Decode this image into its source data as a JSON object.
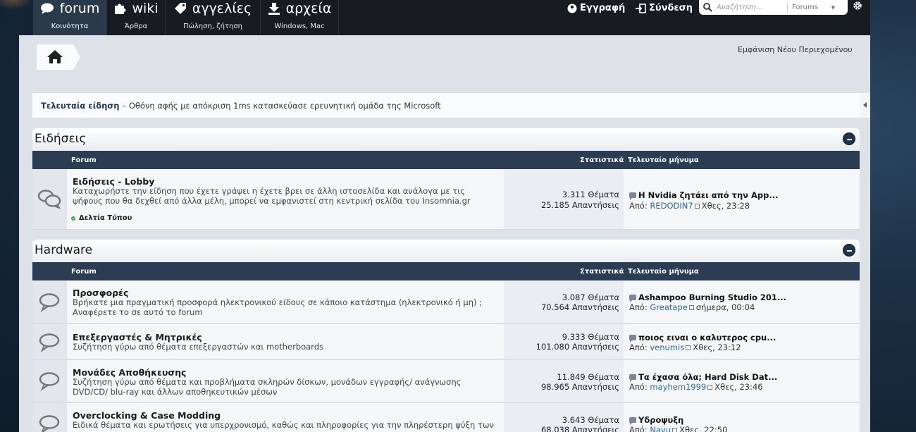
{
  "nav": {
    "tabs": [
      {
        "label": "forum",
        "sub": "Κοινότητα"
      },
      {
        "label": "wiki",
        "sub": "Άρθρα"
      },
      {
        "label": "αγγελίες",
        "sub": "Πώληση, ζήτηση"
      },
      {
        "label": "αρχεία",
        "sub": "Windows, Mac"
      }
    ],
    "register": "Εγγραφή",
    "login": "Σύνδεση",
    "search_placeholder": "Αναζήτηση...",
    "search_scope": "Forums"
  },
  "whats_new": "Εμφάνιση Νέου Περιεχομένου",
  "news": {
    "label": "Τελευταία είδηση",
    "text": "– Οθόνη αφής με απόκριση 1ms κατασκεύασε ερευνητική ομάδα της Microsoft"
  },
  "columns": {
    "forum": "Forum",
    "stats": "Στατιστικά",
    "last": "Τελευταίο μήνυμα"
  },
  "sections": [
    {
      "title": "Ειδήσεις",
      "forums": [
        {
          "title": "Ειδήσεις - Lobby",
          "desc": "Καταχωρήστε την είδηση που έχετε γράψει η έχετε βρει σε άλλη ιστοσελίδα και ανάλογα με τις ψήφους που θα δεχθεί από άλλα μέλη, μπορεί να εμφανιστεί στη κεντρική σελίδα του Insomnia.gr",
          "subforum": "Δελτία Τύπου",
          "threads": "3.311 Θέματα",
          "posts": "25.185 Απαντήσεις",
          "last_title": "Η Nvidia ζητάει από την App...",
          "by": "Από:",
          "user": "REDODIN7",
          "time": "Χθες, 23:28"
        }
      ]
    },
    {
      "title": "Hardware",
      "forums": [
        {
          "title": "Προσφορές",
          "desc": "Βρήκατε μια πραγματική προσφορά ηλεκτρονικού είδους σε κάποιο κατάστημα (ηλεκτρονικό ή μη) ; Αναφέρετε το σε αυτό το forum",
          "threads": "3.087 Θέματα",
          "posts": "70.564 Απαντήσεις",
          "last_title": "Ashampoo Burning Studio 201...",
          "by": "Από:",
          "user": "Greatape",
          "time": "σήμερα, 00:04"
        },
        {
          "title": "Επεξεργαστές & Μητρικές",
          "desc": "Συζήτηση γύρω από θέματα επεξεργαστών και motherboards",
          "threads": "9.333 Θέματα",
          "posts": "101.080 Απαντήσεις",
          "last_title": "ποιος ειναι ο καλυτερος cpu...",
          "by": "Από:",
          "user": "venumis",
          "time": "Χθες, 23:12"
        },
        {
          "title": "Μονάδες Αποθήκευσης",
          "desc": "Συζήτηση γύρω από θέματα και προβλήματα σκληρών δίσκων, μονάδων εγγραφής/ ανάγνωσης DVD/CD/ blu-ray και άλλων αποθηκευτικών μέσων",
          "threads": "11.849 Θέματα",
          "posts": "98.965 Απαντήσεις",
          "last_title": "Τα έχασα όλα; Hard Disk Dat...",
          "by": "Από:",
          "user": "mayhem1999",
          "time": "Χθες, 23:46"
        },
        {
          "title": "Overclocking & Case Modding",
          "desc": "Ειδικά θέματα και ερωτήσεις για υπερχρονισμό, καθώς και πληροφορίες για την πληρέστερη ψύξη των",
          "threads": "3.643 Θέματα",
          "posts": "68.038 Απαντήσεις",
          "last_title": "Υδροψυξη",
          "by": "Από:",
          "user": "Navu",
          "time": "Χθες, 22:50"
        }
      ]
    }
  ]
}
